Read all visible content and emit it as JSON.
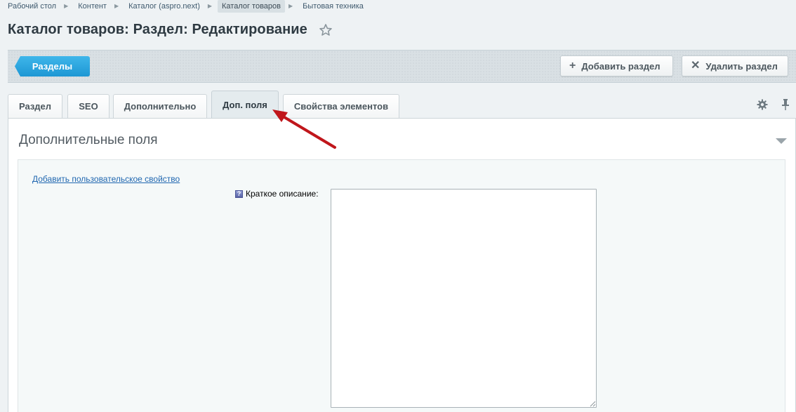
{
  "breadcrumbs": [
    {
      "label": "Рабочий стол"
    },
    {
      "label": "Контент"
    },
    {
      "label": "Каталог (aspro.next)"
    },
    {
      "label": "Каталог товаров"
    },
    {
      "label": "Бытовая техника"
    }
  ],
  "page": {
    "title": "Каталог товаров: Раздел: Редактирование",
    "favorite_icon": "star-icon"
  },
  "toolbar": {
    "sections_label": "Разделы",
    "add_section_label": "Добавить раздел",
    "delete_section_label": "Удалить раздел"
  },
  "tabs": [
    {
      "label": "Раздел"
    },
    {
      "label": "SEO"
    },
    {
      "label": "Дополнительно"
    },
    {
      "label": "Доп. поля",
      "active": true
    },
    {
      "label": "Свойства элементов"
    }
  ],
  "section": {
    "title": "Дополнительные поля",
    "add_property_link": "Добавить пользовательское свойство",
    "short_description_label": "Краткое описание:",
    "short_description_value": ""
  },
  "colors": {
    "accent": "#1d97d4",
    "arrow": "#c0161b",
    "link": "#2067b0"
  }
}
